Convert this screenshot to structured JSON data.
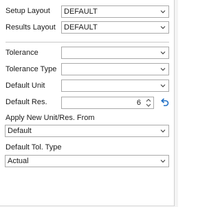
{
  "setup_layout": {
    "label": "Setup Layout",
    "value": "DEFAULT"
  },
  "results_layout": {
    "label": "Results Layout",
    "value": "DEFAULT"
  },
  "tolerance": {
    "label": "Tolerance",
    "value": ""
  },
  "tolerance_type": {
    "label": "Tolerance Type",
    "value": ""
  },
  "default_unit": {
    "label": "Default Unit",
    "value": ""
  },
  "default_res": {
    "label": "Default Res.",
    "value": "6"
  },
  "apply_new_unit_res_from": {
    "label": "Apply New Unit/Res. From",
    "value": "Default"
  },
  "default_tol_type": {
    "label": "Default Tol. Type",
    "value": "Actual"
  },
  "icons": {
    "dropdown": "chevron-down-icon",
    "spin_up": "spin-up-icon",
    "spin_down": "spin-down-icon",
    "reset": "undo-arrow-icon"
  },
  "colors": {
    "reset_icon": "#1f6fc5",
    "border": "#a9a9a9"
  }
}
